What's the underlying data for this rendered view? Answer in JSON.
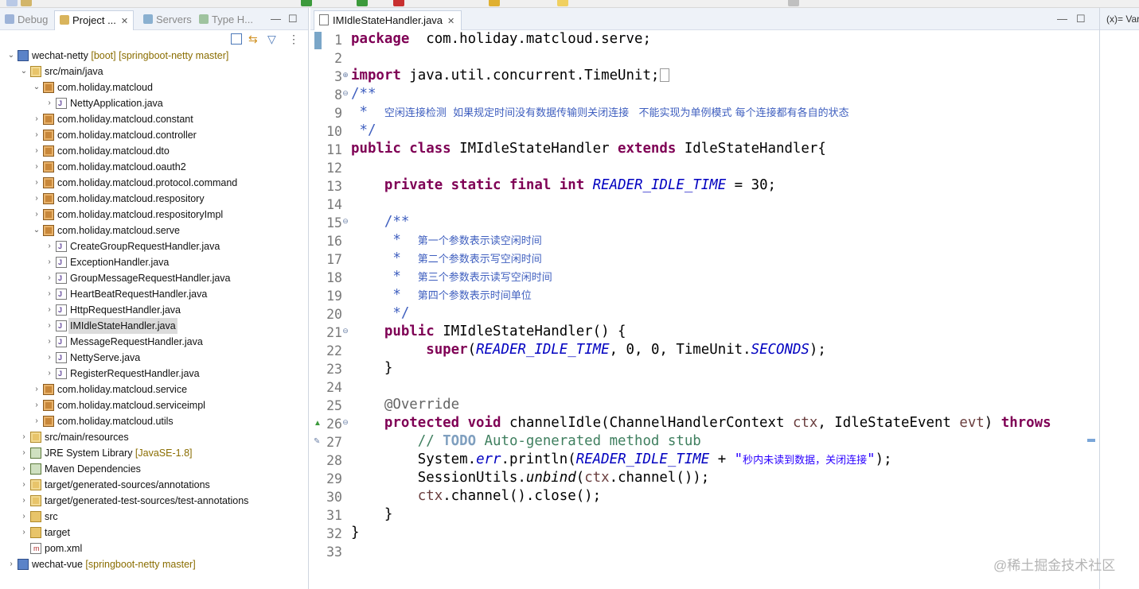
{
  "explorer": {
    "tabs": [
      {
        "label": "Debug",
        "active": false
      },
      {
        "label": "Project ...",
        "active": true
      },
      {
        "label": "Servers",
        "active": false
      },
      {
        "label": "Type H...",
        "active": false
      }
    ],
    "tree": [
      {
        "label": "wechat-netty",
        "extra": " [boot] [springboot-netty master]",
        "icon": "project-icon",
        "level": 0,
        "expanded": true
      },
      {
        "label": "src/main/java",
        "extra": "",
        "icon": "source-folder-icon",
        "level": 1,
        "expanded": true
      },
      {
        "label": "com.holiday.matcloud",
        "extra": "",
        "icon": "package-icon",
        "level": 2,
        "expanded": true
      },
      {
        "label": "NettyApplication.java",
        "extra": "",
        "icon": "java-file-icon",
        "level": 3,
        "expanded": false
      },
      {
        "label": "com.holiday.matcloud.constant",
        "extra": "",
        "icon": "package-icon",
        "level": 2,
        "expanded": false
      },
      {
        "label": "com.holiday.matcloud.controller",
        "extra": "",
        "icon": "package-icon",
        "level": 2,
        "expanded": false
      },
      {
        "label": "com.holiday.matcloud.dto",
        "extra": "",
        "icon": "package-icon",
        "level": 2,
        "expanded": false
      },
      {
        "label": "com.holiday.matcloud.oauth2",
        "extra": "",
        "icon": "package-icon",
        "level": 2,
        "expanded": false
      },
      {
        "label": "com.holiday.matcloud.protocol.command",
        "extra": "",
        "icon": "package-icon",
        "level": 2,
        "expanded": false
      },
      {
        "label": "com.holiday.matcloud.respository",
        "extra": "",
        "icon": "package-icon",
        "level": 2,
        "expanded": false
      },
      {
        "label": "com.holiday.matcloud.respositoryImpl",
        "extra": "",
        "icon": "package-icon",
        "level": 2,
        "expanded": false
      },
      {
        "label": "com.holiday.matcloud.serve",
        "extra": "",
        "icon": "package-icon",
        "level": 2,
        "expanded": true
      },
      {
        "label": "CreateGroupRequestHandler.java",
        "extra": "",
        "icon": "java-file-icon",
        "level": 3,
        "expanded": false
      },
      {
        "label": "ExceptionHandler.java",
        "extra": "",
        "icon": "java-file-icon",
        "level": 3,
        "expanded": false
      },
      {
        "label": "GroupMessageRequestHandler.java",
        "extra": "",
        "icon": "java-file-icon",
        "level": 3,
        "expanded": false
      },
      {
        "label": "HeartBeatRequestHandler.java",
        "extra": "",
        "icon": "java-file-icon",
        "level": 3,
        "expanded": false
      },
      {
        "label": "HttpRequestHandler.java",
        "extra": "",
        "icon": "java-file-icon",
        "level": 3,
        "expanded": false
      },
      {
        "label": "IMIdleStateHandler.java",
        "extra": "",
        "icon": "java-file-icon",
        "level": 3,
        "expanded": false,
        "selected": true
      },
      {
        "label": "MessageRequestHandler.java",
        "extra": "",
        "icon": "java-file-icon",
        "level": 3,
        "expanded": false
      },
      {
        "label": "NettyServe.java",
        "extra": "",
        "icon": "java-file-icon",
        "level": 3,
        "expanded": false
      },
      {
        "label": "RegisterRequestHandler.java",
        "extra": "",
        "icon": "java-file-icon",
        "level": 3,
        "expanded": false
      },
      {
        "label": "com.holiday.matcloud.service",
        "extra": "",
        "icon": "package-icon",
        "level": 2,
        "expanded": false
      },
      {
        "label": "com.holiday.matcloud.serviceimpl",
        "extra": "",
        "icon": "package-icon",
        "level": 2,
        "expanded": false
      },
      {
        "label": "com.holiday.matcloud.utils",
        "extra": "",
        "icon": "package-icon",
        "level": 2,
        "expanded": false
      },
      {
        "label": "src/main/resources",
        "extra": "",
        "icon": "source-folder-icon",
        "level": 1,
        "expanded": false
      },
      {
        "label": "JRE System Library",
        "extra": " [JavaSE-1.8]",
        "icon": "library-icon",
        "level": 1,
        "expanded": false
      },
      {
        "label": "Maven Dependencies",
        "extra": "",
        "icon": "library-icon",
        "level": 1,
        "expanded": false
      },
      {
        "label": "target/generated-sources/annotations",
        "extra": "",
        "icon": "source-folder-icon",
        "level": 1,
        "expanded": false
      },
      {
        "label": "target/generated-test-sources/test-annotations",
        "extra": "",
        "icon": "source-folder-icon",
        "level": 1,
        "expanded": false
      },
      {
        "label": "src",
        "extra": "",
        "icon": "folder-icon",
        "level": 1,
        "expanded": false
      },
      {
        "label": "target",
        "extra": "",
        "icon": "folder-icon",
        "level": 1,
        "expanded": false
      },
      {
        "label": "pom.xml",
        "extra": "",
        "icon": "xml-file-icon",
        "level": 1,
        "expanded": false,
        "leaf": true
      },
      {
        "label": "wechat-vue",
        "extra": " [springboot-netty master]",
        "icon": "project-icon",
        "level": 0,
        "expanded": false
      }
    ]
  },
  "editor": {
    "tab_label": "IMIdleStateHandler.java",
    "tab_close": "✕",
    "lines": [
      {
        "no": "1",
        "fold": "",
        "segs": [
          [
            "kw",
            "package"
          ],
          [
            "",
            "  com.holiday.matcloud.serve;"
          ]
        ]
      },
      {
        "no": "2",
        "fold": "",
        "segs": []
      },
      {
        "no": "3",
        "fold": "⊕",
        "segs": [
          [
            "kw",
            "import"
          ],
          [
            "",
            " java.util.concurrent.TimeUnit;"
          ]
        ],
        "box": true
      },
      {
        "no": "8",
        "fold": "⊖",
        "segs": [
          [
            "cm",
            "/**"
          ]
        ]
      },
      {
        "no": "9",
        "fold": "",
        "segs": [
          [
            "cm",
            " *  "
          ],
          [
            "cmcn",
            "空闲连接检测  如果规定时间没有数据传输则关闭连接   不能实现为单例模式 每个连接都有各自的状态"
          ]
        ]
      },
      {
        "no": "10",
        "fold": "",
        "segs": [
          [
            "cm",
            " */"
          ]
        ]
      },
      {
        "no": "11",
        "fold": "",
        "segs": [
          [
            "kw",
            "public class"
          ],
          [
            "",
            " IMIdleStateHandler "
          ],
          [
            "kw",
            "extends"
          ],
          [
            "",
            " IdleStateHandler{"
          ]
        ]
      },
      {
        "no": "12",
        "fold": "",
        "segs": []
      },
      {
        "no": "13",
        "fold": "",
        "segs": [
          [
            "",
            "    "
          ],
          [
            "kw",
            "private static final int"
          ],
          [
            "",
            " "
          ],
          [
            "fld",
            "READER_IDLE_TIME"
          ],
          [
            "",
            " = 30;"
          ]
        ]
      },
      {
        "no": "14",
        "fold": "",
        "segs": []
      },
      {
        "no": "15",
        "fold": "⊖",
        "segs": [
          [
            "cm",
            "    /**"
          ]
        ]
      },
      {
        "no": "16",
        "fold": "",
        "segs": [
          [
            "cm",
            "     *  "
          ],
          [
            "cmcn",
            "第一个参数表示读空闲时间"
          ]
        ]
      },
      {
        "no": "17",
        "fold": "",
        "segs": [
          [
            "cm",
            "     *  "
          ],
          [
            "cmcn",
            "第二个参数表示写空闲时间"
          ]
        ]
      },
      {
        "no": "18",
        "fold": "",
        "segs": [
          [
            "cm",
            "     *  "
          ],
          [
            "cmcn",
            "第三个参数表示读写空闲时间"
          ]
        ]
      },
      {
        "no": "19",
        "fold": "",
        "segs": [
          [
            "cm",
            "     *  "
          ],
          [
            "cmcn",
            "第四个参数表示时间单位"
          ]
        ]
      },
      {
        "no": "20",
        "fold": "",
        "segs": [
          [
            "cm",
            "     */"
          ]
        ]
      },
      {
        "no": "21",
        "fold": "⊖",
        "segs": [
          [
            "",
            "    "
          ],
          [
            "kw",
            "public"
          ],
          [
            "",
            " IMIdleStateHandler() {"
          ]
        ]
      },
      {
        "no": "22",
        "fold": "",
        "segs": [
          [
            "",
            "         "
          ],
          [
            "kw",
            "super"
          ],
          [
            "",
            "("
          ],
          [
            "fld",
            "READER_IDLE_TIME"
          ],
          [
            "",
            ", 0, 0, TimeUnit."
          ],
          [
            "fld",
            "SECONDS"
          ],
          [
            "",
            ");"
          ]
        ]
      },
      {
        "no": "23",
        "fold": "",
        "segs": [
          [
            "",
            "    }"
          ]
        ]
      },
      {
        "no": "24",
        "fold": "",
        "segs": []
      },
      {
        "no": "25",
        "fold": "",
        "segs": [
          [
            "ann",
            "    @Override"
          ]
        ]
      },
      {
        "no": "26",
        "fold": "⊖",
        "segs": [
          [
            "",
            "    "
          ],
          [
            "kw",
            "protected void"
          ],
          [
            "",
            " channelIdle(ChannelHandlerContext "
          ],
          [
            "var",
            "ctx"
          ],
          [
            "",
            ", IdleStateEvent "
          ],
          [
            "var",
            "evt"
          ],
          [
            "",
            ") "
          ],
          [
            "kw",
            "throws"
          ]
        ],
        "marker": "▲"
      },
      {
        "no": "27",
        "fold": "",
        "segs": [
          [
            "lc",
            "        // "
          ],
          [
            "todo",
            "TODO"
          ],
          [
            "lc",
            " Auto-generated method stub"
          ]
        ],
        "marker": "✎"
      },
      {
        "no": "28",
        "fold": "",
        "segs": [
          [
            "",
            "        System."
          ],
          [
            "fld",
            "err"
          ],
          [
            "",
            ".println("
          ],
          [
            "fld",
            "READER_IDLE_TIME"
          ],
          [
            "",
            " + "
          ],
          [
            "st",
            "\""
          ],
          [
            "stcn",
            "秒内未读到数据，关闭连接"
          ],
          [
            "st",
            "\""
          ],
          [
            "",
            ");"
          ]
        ]
      },
      {
        "no": "29",
        "fold": "",
        "segs": [
          [
            "",
            "        SessionUtils."
          ],
          [
            "sm",
            "unbind"
          ],
          [
            "",
            "("
          ],
          [
            "var",
            "ctx"
          ],
          [
            "",
            ".channel());"
          ]
        ]
      },
      {
        "no": "30",
        "fold": "",
        "segs": [
          [
            "",
            "        "
          ],
          [
            "var",
            "ctx"
          ],
          [
            "",
            ".channel().close();"
          ]
        ]
      },
      {
        "no": "31",
        "fold": "",
        "segs": [
          [
            "",
            "    }"
          ]
        ]
      },
      {
        "no": "32",
        "fold": "",
        "segs": [
          [
            "",
            "}"
          ]
        ]
      },
      {
        "no": "33",
        "fold": "",
        "segs": []
      }
    ]
  },
  "right_panel": {
    "tab_label": "(x)= Var"
  },
  "watermark": "@稀土掘金技术社区",
  "colors": {
    "keyword": "#7f0055",
    "comment": "#3f5fbf",
    "field": "#0000c0",
    "string": "#2a00ff",
    "line_comment": "#3f7f5f"
  }
}
